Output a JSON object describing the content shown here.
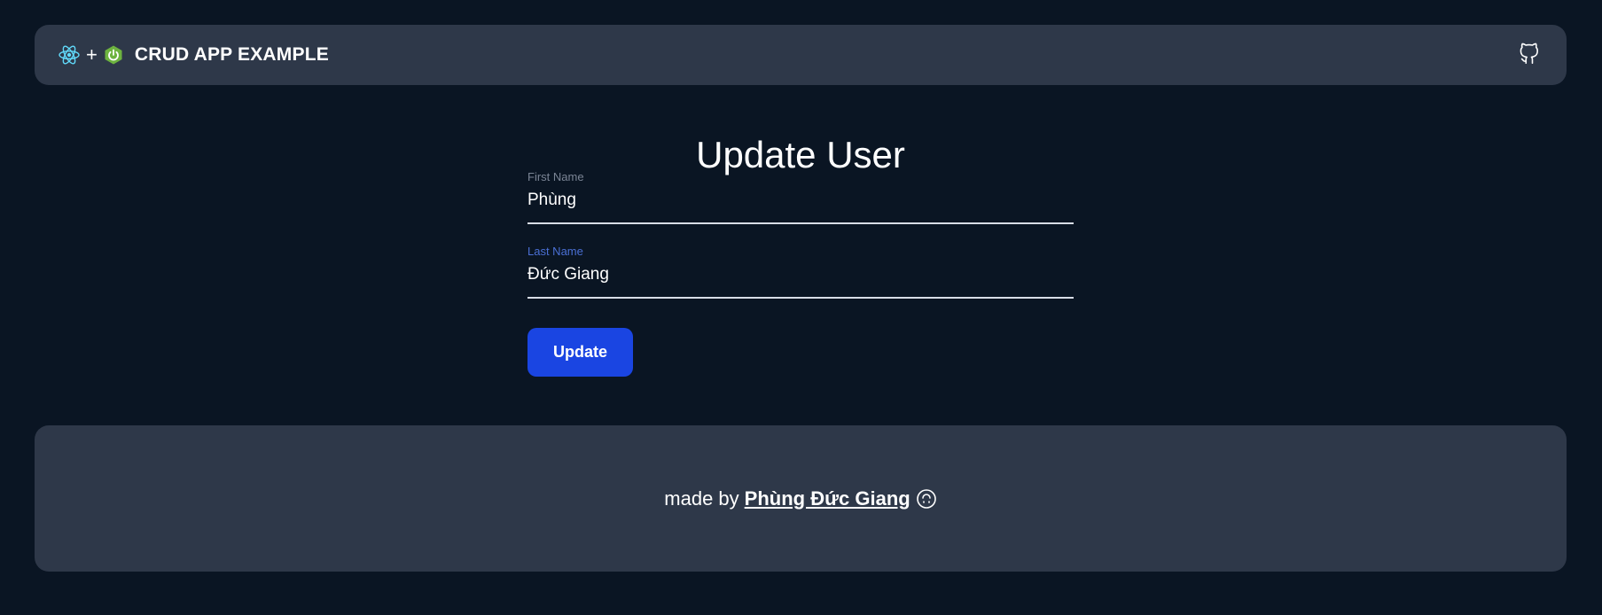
{
  "navbar": {
    "brand_plus": "+",
    "brand_title": "CRUD APP EXAMPLE",
    "icons": [
      "react-icon",
      "spring-icon",
      "github-icon"
    ]
  },
  "form": {
    "title": "Update User",
    "first_name": {
      "label": "First Name",
      "value": "Phùng"
    },
    "last_name": {
      "label": "Last Name",
      "value": "Đức Giang"
    },
    "submit_label": "Update"
  },
  "footer": {
    "made_by": "made by",
    "author": "Phùng Đức Giang",
    "icon": "upside-down-smile-icon"
  },
  "colors": {
    "background": "#0a1523",
    "panel": "#2e3849",
    "accent": "#1a45e2",
    "focused_label": "#4a6fd4",
    "react": "#61dafb",
    "spring": "#6db33f"
  }
}
